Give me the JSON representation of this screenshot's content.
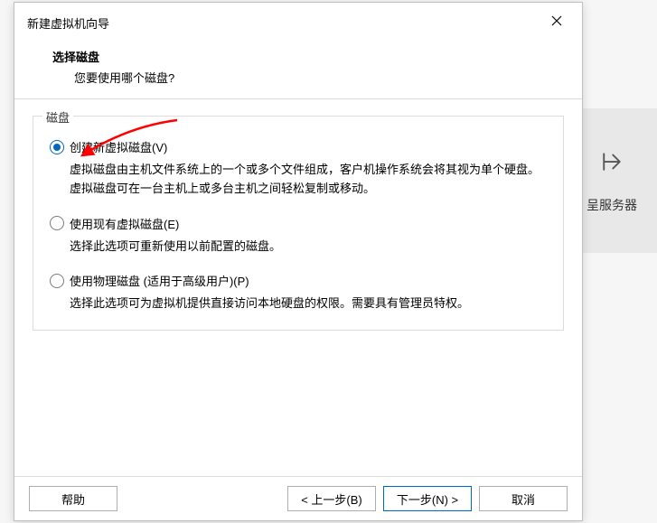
{
  "background": {
    "label": "呈服务器"
  },
  "dialog": {
    "title": "新建虚拟机向导",
    "header": {
      "title": "选择磁盘",
      "subtitle": "您要使用哪个磁盘?"
    },
    "fieldset_legend": "磁盘",
    "options": [
      {
        "label": "创建新虚拟磁盘(V)",
        "description": "虚拟磁盘由主机文件系统上的一个或多个文件组成，客户机操作系统会将其视为单个硬盘。虚拟磁盘可在一台主机上或多台主机之间轻松复制或移动。",
        "checked": true
      },
      {
        "label": "使用现有虚拟磁盘(E)",
        "description": "选择此选项可重新使用以前配置的磁盘。",
        "checked": false
      },
      {
        "label": "使用物理磁盘 (适用于高级用户)(P)",
        "description": "选择此选项可为虚拟机提供直接访问本地硬盘的权限。需要具有管理员特权。",
        "checked": false
      }
    ],
    "buttons": {
      "help": "帮助",
      "back": "< 上一步(B)",
      "next": "下一步(N) >",
      "cancel": "取消"
    }
  }
}
